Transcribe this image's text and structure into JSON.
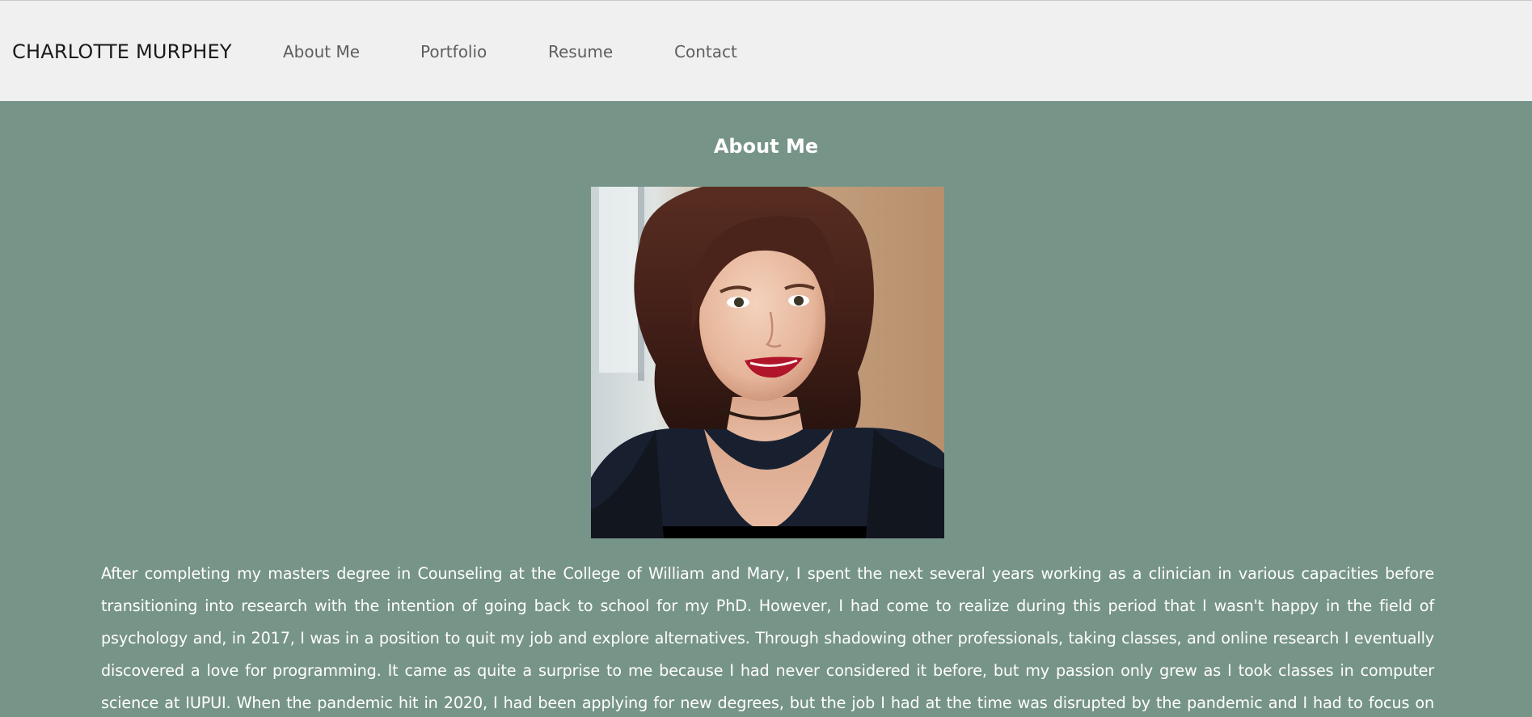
{
  "header": {
    "brand": "CHARLOTTE MURPHEY",
    "nav": {
      "about": "About Me",
      "portfolio": "Portfolio",
      "resume": "Resume",
      "contact": "Contact"
    }
  },
  "main": {
    "title": "About Me",
    "bio": "After completing my masters degree in Counseling at the College of William and Mary, I spent the next several years working as a clinician in various capacities before transitioning into research with the intention of going back to school for my PhD. However, I had come to realize during this period that I wasn't happy in the field of psychology and, in 2017, I was in a position to quit my job and explore alternatives. Through shadowing other professionals, taking classes, and online research I eventually discovered a love for programming. It came as quite a surprise to me because I had never considered it before, but my passion only grew as I took classes in computer science at IUPUI. When the pandemic hit in 2020, I had been applying for new degrees, but the job I had at the time was disrupted by the pandemic and I had to focus on earning money for a while. Once I"
  },
  "colors": {
    "page_background": "#779488",
    "nav_background": "#f0f0f0",
    "text_light": "#ffffff"
  }
}
